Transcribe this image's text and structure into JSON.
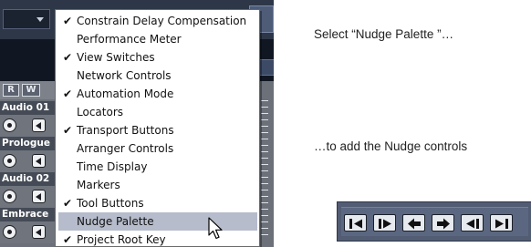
{
  "menu": {
    "items": [
      {
        "label": "Constrain Delay Compensation",
        "checked": true,
        "highlighted": false
      },
      {
        "label": "Performance Meter",
        "checked": false,
        "highlighted": false
      },
      {
        "label": "View Switches",
        "checked": true,
        "highlighted": false
      },
      {
        "label": "Network Controls",
        "checked": false,
        "highlighted": false
      },
      {
        "label": "Automation Mode",
        "checked": true,
        "highlighted": false
      },
      {
        "label": "Locators",
        "checked": false,
        "highlighted": false
      },
      {
        "label": "Transport Buttons",
        "checked": true,
        "highlighted": false
      },
      {
        "label": "Arranger Controls",
        "checked": false,
        "highlighted": false
      },
      {
        "label": "Time Display",
        "checked": false,
        "highlighted": false
      },
      {
        "label": "Markers",
        "checked": false,
        "highlighted": false
      },
      {
        "label": "Tool Buttons",
        "checked": true,
        "highlighted": false
      },
      {
        "label": "Nudge Palette",
        "checked": false,
        "highlighted": true
      },
      {
        "label": "Project Root Key",
        "checked": true,
        "highlighted": false
      }
    ],
    "check_glyph": "✔"
  },
  "tracks": [
    {
      "name": "Audio 01"
    },
    {
      "name": "Prologue"
    },
    {
      "name": "Audio 02"
    },
    {
      "name": "Embrace"
    }
  ],
  "view_buttons": [
    "R",
    "W"
  ],
  "captions": {
    "select": "Select “Nudge Palette ”…",
    "add": "…to add the Nudge controls"
  },
  "nudge_palette": {
    "buttons": [
      {
        "icon": "trim-start-left-icon"
      },
      {
        "icon": "trim-start-right-icon"
      },
      {
        "icon": "move-left-icon"
      },
      {
        "icon": "move-right-icon"
      },
      {
        "icon": "trim-end-left-icon"
      },
      {
        "icon": "trim-end-right-icon"
      }
    ]
  },
  "colors": {
    "highlight": "#b6bccb",
    "app_bg": "#6b7079",
    "palette_bg": "#525c73"
  }
}
